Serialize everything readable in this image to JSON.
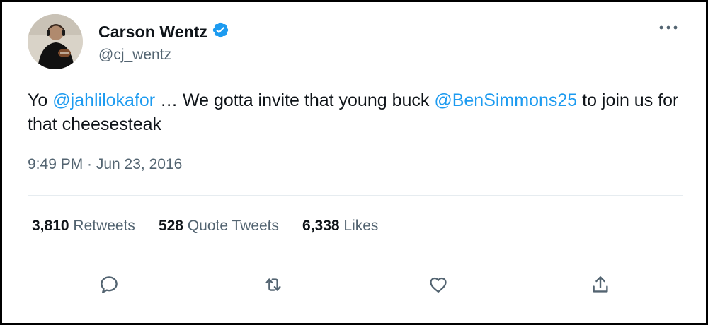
{
  "tweet": {
    "author": {
      "display_name": "Carson Wentz",
      "handle": "@cj_wentz",
      "verified": true
    },
    "text_segments": [
      {
        "type": "text",
        "value": "Yo "
      },
      {
        "type": "mention",
        "value": "@jahlilokafor"
      },
      {
        "type": "text",
        "value": " … We gotta invite that young buck "
      },
      {
        "type": "mention",
        "value": "@BenSimmons25"
      },
      {
        "type": "text",
        "value": " to join us for that cheesesteak"
      }
    ],
    "timestamp": "9:49 PM · Jun 23, 2016",
    "stats": [
      {
        "count": "3,810",
        "label": " Retweets"
      },
      {
        "count": "528",
        "label": " Quote Tweets"
      },
      {
        "count": "6,338",
        "label": " Likes"
      }
    ],
    "actions": [
      {
        "icon": "reply-icon"
      },
      {
        "icon": "retweet-icon"
      },
      {
        "icon": "like-icon"
      },
      {
        "icon": "share-icon"
      }
    ]
  },
  "colors": {
    "accent": "#1d9bf0",
    "text_primary": "#0f1419",
    "text_secondary": "#536471",
    "divider": "#e6ecf0"
  }
}
